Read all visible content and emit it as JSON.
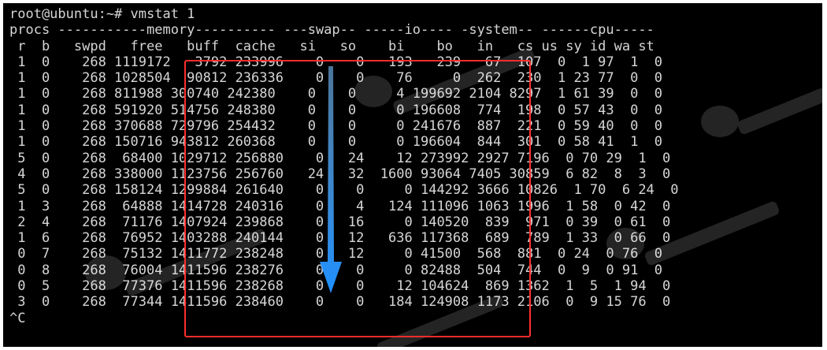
{
  "terminal": {
    "prompt_line": "root@ubuntu:~# vmstat 1",
    "group_header": "procs -----------memory---------- ---swap-- -----io---- -system-- ------cpu-----",
    "column_header": " r  b   swpd   free   buff  cache   si   so    bi    bo   in   cs us sy id wa st",
    "rows": [
      " 1  0    268 1119172   3792 233996    0    0   193   239   67  107  0  1 97  1  0",
      " 1  0    268 1028504  90812 236336    0    0    76     0  262  230  1 23 77  0  0",
      " 1  0    268 811988 300740 242380    0    0     4 199692 2104 8297  1 61 39  0  0",
      " 1  0    268 591920 514756 248380    0    0     0 196608  774  198  0 57 43  0  0",
      " 1  0    268 370688 729796 254432    0    0     0 241676  887  221  0 59 40  0  0",
      " 1  0    268 150716 943812 260368    0    0     0 196604  844  301  0 58 41  1  0",
      " 5  0    268  68400 1029712 256880    0   24    12 273992 2927 7196  0 70 29  1  0",
      " 4  0    268 338000 1123756 256760   24   32  1600 93064 7405 30859  6 82  8  3  0",
      " 5  0    268 158124 1299884 261640    0    0     0 144292 3666 10826  1 70  6 24  0",
      " 1  3    268  64888 1414728 240316    0    4   124 111096 1063 1996  1 58  0 42  0",
      " 2  4    268  71176 1407924 239868    0   16     0 140520  839  971  0 39  0 61  0",
      " 1  6    268  76952 1403288 240144    0   12   636 117368  689  789  1 33  0 66  0",
      " 0  7    268  75132 1411772 238248    0   12     0 41500  568  881  0 24  0 76  0",
      " 0  8    268  76004 1411596 238276    0    0     0 82488  504  744  0  9  0 91  0",
      " 0  5    268  77376 1411596 238268    0    0    12 104624  869 1362  1  5  1 94  0",
      " 3  0    268  77344 1411596 238460    0    0   184 124908 1173 2106  0  9 15 76  0"
    ],
    "interrupt_line": "^C"
  },
  "annotations": {
    "box_color": "#ff2d2d",
    "arrow_color": "#1e90ff"
  },
  "colors": {
    "terminal_bg": "#000000",
    "terminal_fg": "#d6d6d6"
  }
}
